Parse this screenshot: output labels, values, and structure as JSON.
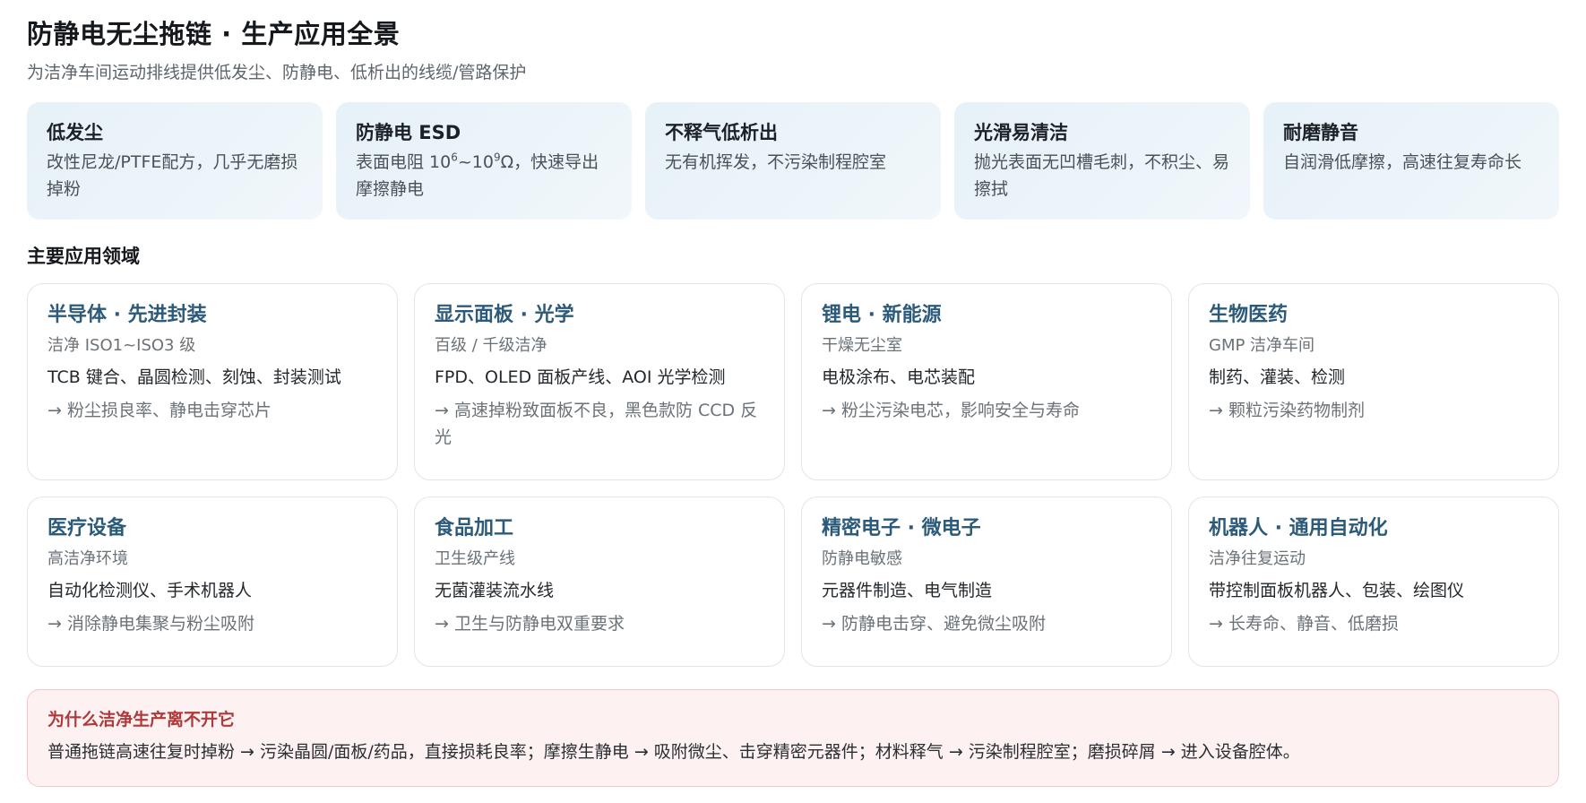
{
  "header": {
    "title": "防静电无尘拖链 · 生产应用全景",
    "subtitle": "为洁净车间运动排线提供低发尘、防静电、低析出的线缆/管路保护"
  },
  "features": [
    {
      "title": "低发尘",
      "desc": "改性尼龙/PTFE配方，几乎无磨损掉粉"
    },
    {
      "title": "防静电 ESD",
      "desc_prefix": "表面电阻 10",
      "exp1": "6",
      "desc_mid": "~10",
      "exp2": "9",
      "desc_suffix": "Ω，快速导出摩擦静电"
    },
    {
      "title": "不释气低析出",
      "desc": "无有机挥发，不污染制程腔室"
    },
    {
      "title": "光滑易清洁",
      "desc": "抛光表面无凹槽毛刺，不积尘、易擦拭"
    },
    {
      "title": "耐磨静音",
      "desc": "自润滑低摩擦，高速往复寿命长"
    }
  ],
  "applications": {
    "heading": "主要应用领域",
    "cards": [
      {
        "title": "半导体 · 先进封装",
        "sub": "洁净 ISO1~ISO3 级",
        "body": "TCB 键合、晶圆检测、刻蚀、封装测试",
        "note": "→ 粉尘损良率、静电击穿芯片"
      },
      {
        "title": "显示面板 · 光学",
        "sub": "百级 / 千级洁净",
        "body": "FPD、OLED 面板产线、AOI 光学检测",
        "note": "→ 高速掉粉致面板不良，黑色款防 CCD 反光"
      },
      {
        "title": "锂电 · 新能源",
        "sub": "干燥无尘室",
        "body": "电极涂布、电芯装配",
        "note": "→ 粉尘污染电芯，影响安全与寿命"
      },
      {
        "title": "生物医药",
        "sub": "GMP 洁净车间",
        "body": "制药、灌装、检测",
        "note": "→ 颗粒污染药物制剂"
      },
      {
        "title": "医疗设备",
        "sub": "高洁净环境",
        "body": "自动化检测仪、手术机器人",
        "note": "→ 消除静电集聚与粉尘吸附"
      },
      {
        "title": "食品加工",
        "sub": "卫生级产线",
        "body": "无菌灌装流水线",
        "note": "→ 卫生与防静电双重要求"
      },
      {
        "title": "精密电子 · 微电子",
        "sub": "防静电敏感",
        "body": "元器件制造、电气制造",
        "note": "→ 防静电击穿、避免微尘吸附"
      },
      {
        "title": "机器人 · 通用自动化",
        "sub": "洁净往复运动",
        "body": "带控制面板机器人、包装、绘图仪",
        "note": "→ 长寿命、静音、低磨损"
      }
    ]
  },
  "callout": {
    "title": "为什么洁净生产离不开它",
    "text": "普通拖链高速往复时掉粉 → 污染晶圆/面板/药品，直接损耗良率；摩擦生静电 → 吸附微尘、击穿精密元器件；材料释气 → 污染制程腔室；磨损碎屑 → 进入设备腔体。"
  },
  "colors": {
    "card_title": "#2c5a7a",
    "feature_bg": "#e6f1f8",
    "callout_bg": "#fdf1f1",
    "callout_title": "#b0393a"
  }
}
